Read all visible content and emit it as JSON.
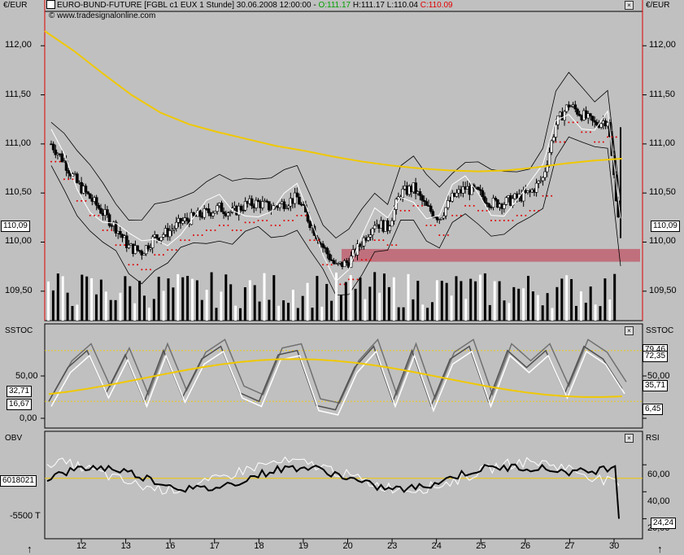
{
  "header": {
    "title_prefix": "EURO-BUND-FUTURE [FGBL c1 EUX  1 Stunde] 30.06.2008 12:00:00 - ",
    "open": "O:111.17",
    "high": " H:111.17",
    "low": " L:110.04",
    "close": " C:110.09",
    "source": "© www.tradesignalonline.com",
    "unit_left": "€/EUR",
    "unit_right": "€/EUR",
    "open_color": "#00a000",
    "close_color": "#e00000"
  },
  "price_axis": {
    "ticks": [
      "112,00",
      "111,50",
      "111,00",
      "110,50",
      "110,00",
      "109,50"
    ],
    "values": [
      112.0,
      111.5,
      111.0,
      110.5,
      110.0,
      109.5
    ],
    "current_left": "110,09",
    "current_right": "110,09"
  },
  "stoch_panel": {
    "name_left": "SSTOC",
    "name_right": "SSTOC",
    "ticks_left": [
      "50,00",
      "0,00"
    ],
    "ticks_right": [
      "50,00"
    ],
    "boxes_left": [
      "32,71",
      "16,67"
    ],
    "boxes_right": [
      "79,46",
      "72,35",
      "35,71",
      "6,45"
    ]
  },
  "obv_panel": {
    "name_left": "OBV",
    "name_right": "RSI",
    "obv_box": "6018021",
    "obv_tick": "-5500 T",
    "rsi_ticks": [
      "60,00",
      "40,00",
      "20,00"
    ],
    "rsi_box": "24,24"
  },
  "x_axis": {
    "labels": [
      "12",
      "13",
      "16",
      "17",
      "18",
      "19",
      "20",
      "23",
      "24",
      "25",
      "26",
      "27",
      "30"
    ]
  },
  "colors": {
    "background": "#c0c0c0",
    "ma_yellow": "#f0c800",
    "band": "#c0707c",
    "dots": "#e00000",
    "accent_red": "#e00000"
  },
  "chart_data": {
    "type": "candlestick",
    "title": "EURO-BUND-FUTURE [FGBL c1 EUX  1 Stunde] 30.06.2008 12:00:00",
    "ohlc_last": {
      "open": 111.17,
      "high": 111.17,
      "low": 110.04,
      "close": 110.09
    },
    "x_days": [
      "12",
      "13",
      "16",
      "17",
      "18",
      "19",
      "20",
      "23",
      "24",
      "25",
      "26",
      "27",
      "30"
    ],
    "ylim": [
      109.2,
      112.35
    ],
    "close_series": [
      111.0,
      110.82,
      110.6,
      110.45,
      110.3,
      110.15,
      109.95,
      109.9,
      110.05,
      110.1,
      110.2,
      110.25,
      110.3,
      110.35,
      110.3,
      110.38,
      110.4,
      110.35,
      110.4,
      110.45,
      110.2,
      109.95,
      109.75,
      109.8,
      110.0,
      110.2,
      110.15,
      110.5,
      110.55,
      110.35,
      110.25,
      110.45,
      110.55,
      110.5,
      110.4,
      110.4,
      110.45,
      110.5,
      110.65,
      111.2,
      111.4,
      111.3,
      111.2,
      111.25,
      110.09
    ],
    "ma200": [
      112.15,
      111.95,
      111.72,
      111.5,
      111.32,
      111.2,
      111.12,
      111.05,
      110.98,
      110.93,
      110.87,
      110.82,
      110.78,
      110.75,
      110.73,
      110.72,
      110.73,
      110.76,
      110.8,
      110.83,
      110.85
    ],
    "stoch_percent": [
      20,
      60,
      80,
      30,
      75,
      20,
      80,
      25,
      70,
      85,
      30,
      20,
      75,
      80,
      15,
      10,
      60,
      85,
      20,
      80,
      15,
      70,
      85,
      20,
      80,
      60,
      80,
      30,
      85,
      70,
      35
    ],
    "rsi_tick_values": [
      60,
      40,
      20
    ],
    "stoch_tick_values": [
      50,
      0
    ]
  }
}
